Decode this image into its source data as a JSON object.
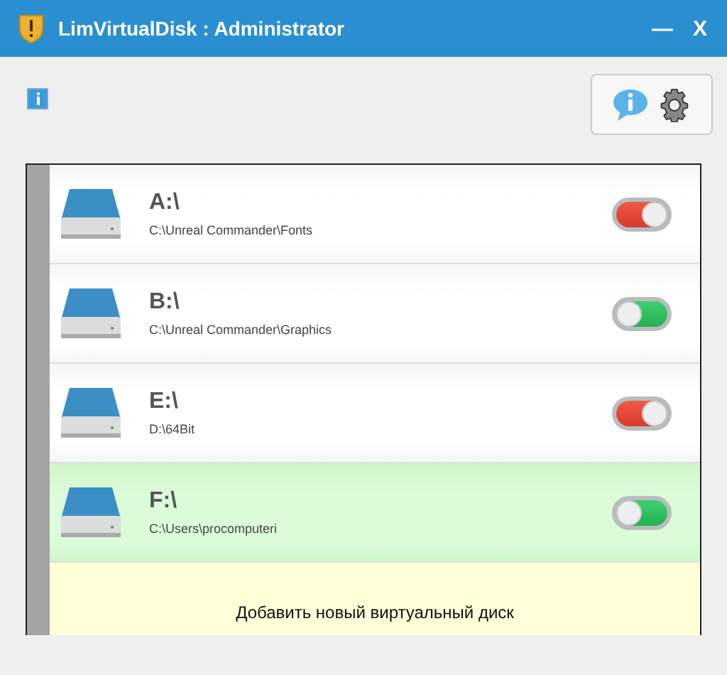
{
  "window": {
    "title": "LimVirtualDisk : Administrator",
    "controls": [
      "—",
      "X"
    ]
  },
  "disks": [
    {
      "letter": "A:\\",
      "path": "C:\\Unreal Commander\\Fonts",
      "on": true,
      "selected": false
    },
    {
      "letter": "B:\\",
      "path": "C:\\Unreal Commander\\Graphics",
      "on": false,
      "selected": false
    },
    {
      "letter": "E:\\",
      "path": "D:\\64Bit",
      "on": true,
      "selected": false
    },
    {
      "letter": "F:\\",
      "path": "C:\\Users\\procomputeri",
      "on": false,
      "selected": true
    }
  ],
  "add_button": "Добавить новый виртуальный диск"
}
